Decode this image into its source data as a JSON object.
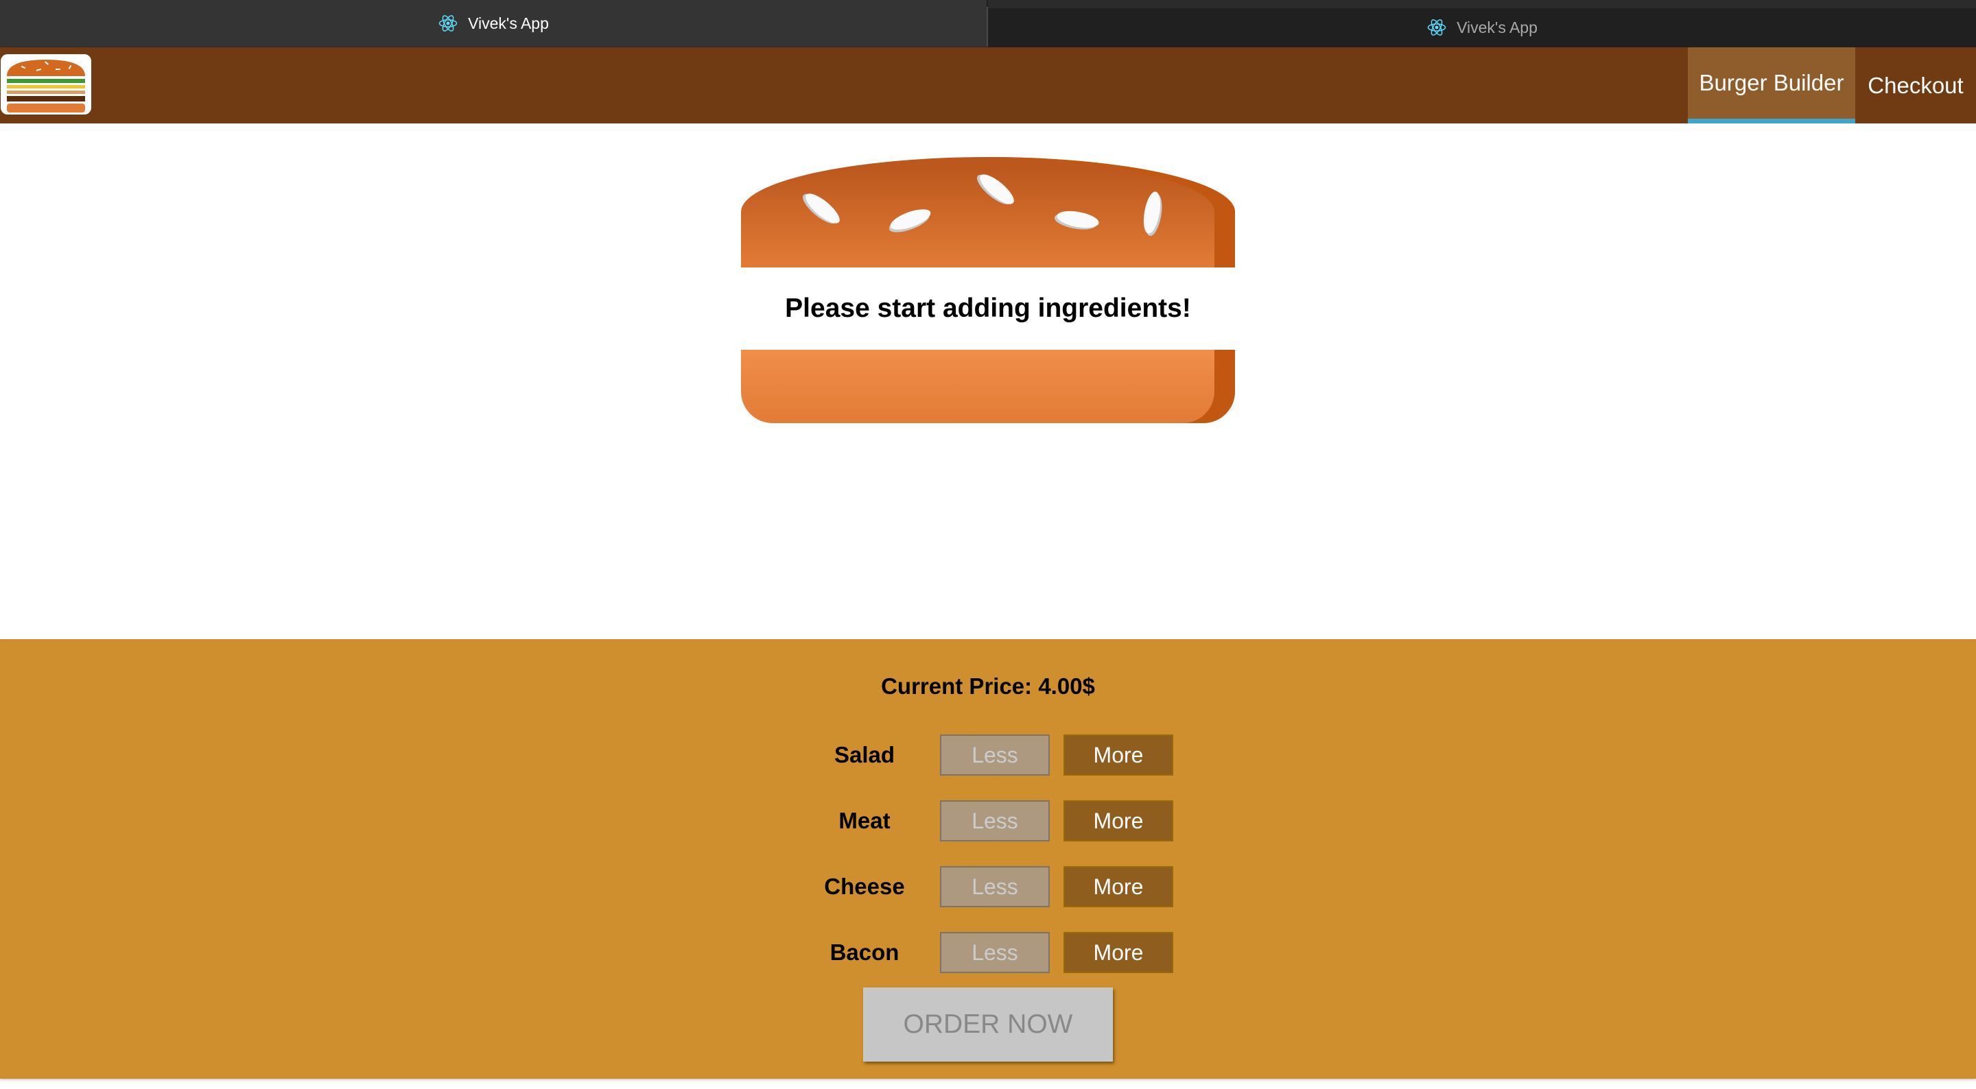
{
  "browser": {
    "tabs": [
      {
        "title": "Vivek's App",
        "active": true,
        "icon": "react-icon"
      },
      {
        "title": "Vivek's App",
        "active": false,
        "icon": "react-icon"
      }
    ]
  },
  "toolbar": {
    "logo": "burger-logo-icon",
    "nav": {
      "builder_label": "Burger Builder",
      "checkout_label": "Checkout"
    },
    "active_item": "Burger Builder"
  },
  "burger": {
    "empty_message": "Please start adding ingredients!"
  },
  "controls": {
    "price_label": "Current Price: 4.00$",
    "ingredients": [
      {
        "label": "Salad",
        "less": "Less",
        "more": "More",
        "less_disabled": true
      },
      {
        "label": "Meat",
        "less": "Less",
        "more": "More",
        "less_disabled": true
      },
      {
        "label": "Cheese",
        "less": "Less",
        "more": "More",
        "less_disabled": true
      },
      {
        "label": "Bacon",
        "less": "Less",
        "more": "More",
        "less_disabled": true
      }
    ],
    "order_button": "ORDER NOW",
    "order_disabled": true
  },
  "colors": {
    "toolbar_bg": "#703b13",
    "active_nav_bg": "#8f5c2c",
    "active_nav_underline": "#40a4c8",
    "controls_bg": "#cf8f2e",
    "more_button_bg": "#8f5e1e",
    "less_button_disabled_bg": "#ac9980"
  }
}
